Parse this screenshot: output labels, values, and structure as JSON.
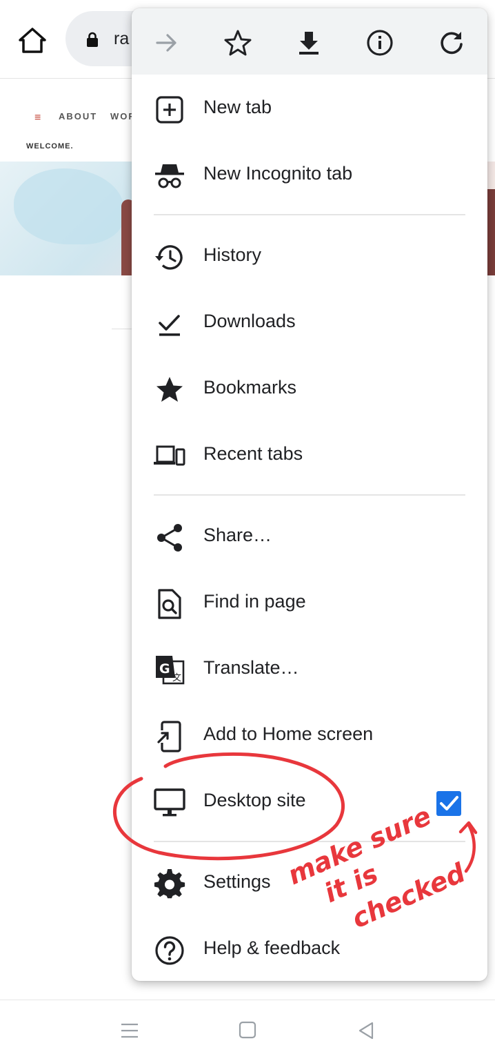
{
  "browser": {
    "url_fragment": "ra",
    "colors": {
      "toolbar_bg": "#f1f3f4",
      "accent": "#1a73e8",
      "annotation": "#e8373c"
    }
  },
  "page": {
    "nav_items": [
      "ABOUT",
      "WOR"
    ],
    "hamburger": "≡",
    "welcome": "WELCOME."
  },
  "menu": {
    "toolbar_icons": [
      "forward-icon",
      "bookmark-star-icon",
      "download-icon",
      "info-icon",
      "refresh-icon"
    ],
    "items": [
      {
        "label": "New tab",
        "icon": "new-tab-icon"
      },
      {
        "label": "New Incognito tab",
        "icon": "incognito-icon"
      },
      {
        "label": "History",
        "icon": "history-icon"
      },
      {
        "label": "Downloads",
        "icon": "downloads-icon"
      },
      {
        "label": "Bookmarks",
        "icon": "bookmarks-star-icon"
      },
      {
        "label": "Recent tabs",
        "icon": "devices-icon"
      },
      {
        "label": "Share…",
        "icon": "share-icon"
      },
      {
        "label": "Find in page",
        "icon": "find-in-page-icon"
      },
      {
        "label": "Translate…",
        "icon": "translate-icon"
      },
      {
        "label": "Add to Home screen",
        "icon": "add-to-home-icon"
      },
      {
        "label": "Desktop site",
        "icon": "desktop-icon",
        "checked": true
      },
      {
        "label": "Settings",
        "icon": "settings-gear-icon"
      },
      {
        "label": "Help & feedback",
        "icon": "help-icon"
      }
    ]
  },
  "annotation": {
    "lines": [
      "make sure",
      "it is",
      "checked"
    ]
  },
  "system_nav": [
    "menu-icon",
    "home-square-icon",
    "back-triangle-icon"
  ]
}
